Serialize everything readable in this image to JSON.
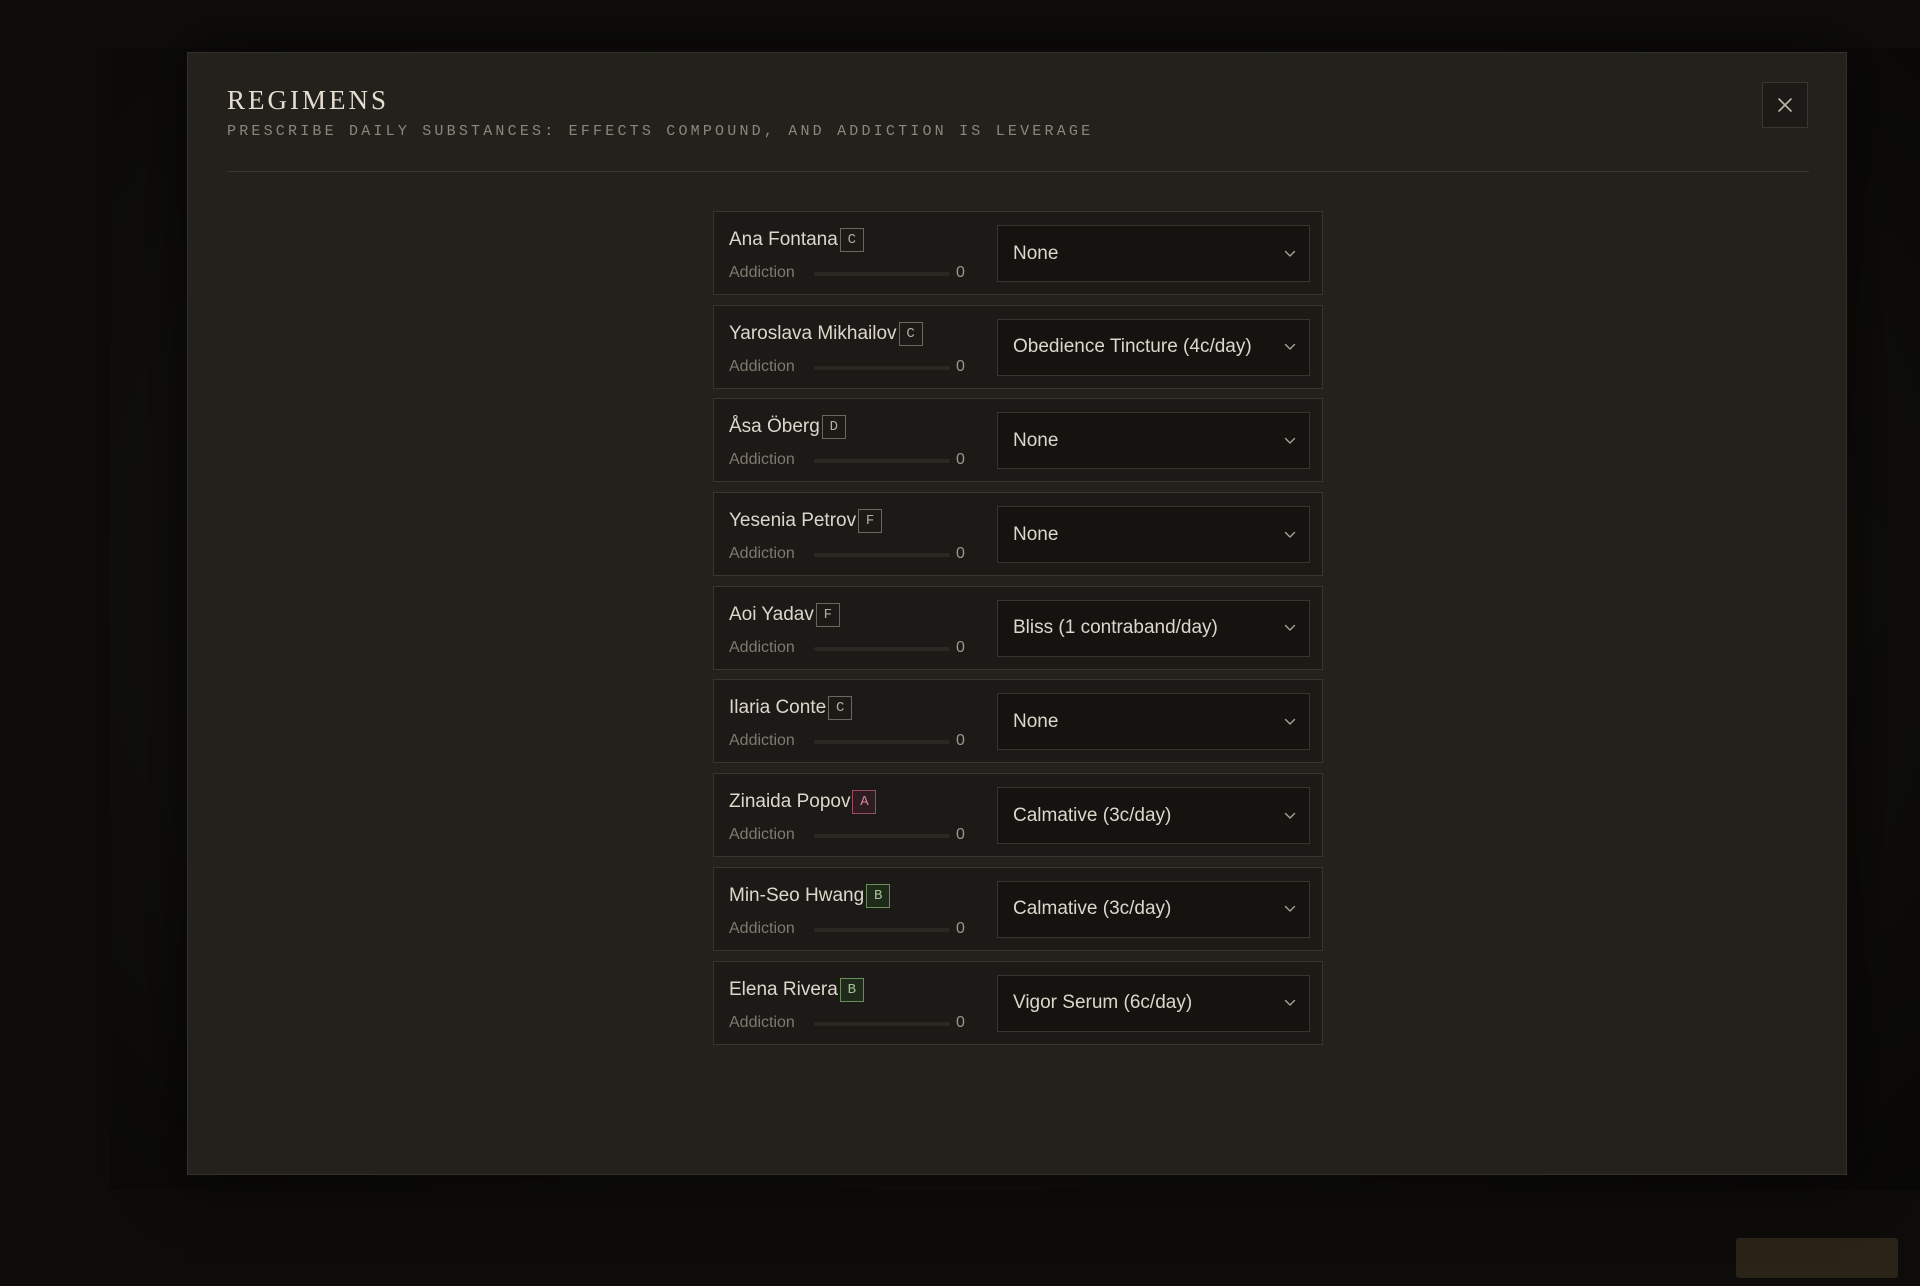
{
  "modal": {
    "title": "REGIMENS",
    "subtitle": "PRESCRIBE DAILY SUBSTANCES: EFFECTS COMPOUND, AND ADDICTION IS LEVERAGE",
    "close_icon": "close-icon"
  },
  "colors": {
    "accent_gold": "#b5a37a",
    "grade_A": "#d2899b",
    "grade_B": "#a6c795",
    "grade_default": "#b4ad9f"
  },
  "addiction_label": "Addiction",
  "rows": [
    {
      "name": "Ana Fontana",
      "grade": "C",
      "addiction": "0",
      "addiction_pct": 0,
      "regimen": "None"
    },
    {
      "name": "Yaroslava Mikhailov",
      "grade": "C",
      "addiction": "0",
      "addiction_pct": 0,
      "regimen": "Obedience Tincture (4c/day)"
    },
    {
      "name": "Åsa Öberg",
      "grade": "D",
      "addiction": "0",
      "addiction_pct": 0,
      "regimen": "None"
    },
    {
      "name": "Yesenia Petrov",
      "grade": "F",
      "addiction": "0",
      "addiction_pct": 0,
      "regimen": "None"
    },
    {
      "name": "Aoi Yadav",
      "grade": "F",
      "addiction": "0",
      "addiction_pct": 0,
      "regimen": "Bliss (1 contraband/day)"
    },
    {
      "name": "Ilaria Conte",
      "grade": "C",
      "addiction": "0",
      "addiction_pct": 0,
      "regimen": "None"
    },
    {
      "name": "Zinaida Popov",
      "grade": "A",
      "addiction": "0",
      "addiction_pct": 0,
      "regimen": "Calmative (3c/day)"
    },
    {
      "name": "Min-Seo Hwang",
      "grade": "B",
      "addiction": "0",
      "addiction_pct": 0,
      "regimen": "Calmative (3c/day)"
    },
    {
      "name": "Elena Rivera",
      "grade": "B",
      "addiction": "0",
      "addiction_pct": 0,
      "regimen": "Vigor Serum (6c/day)"
    }
  ]
}
